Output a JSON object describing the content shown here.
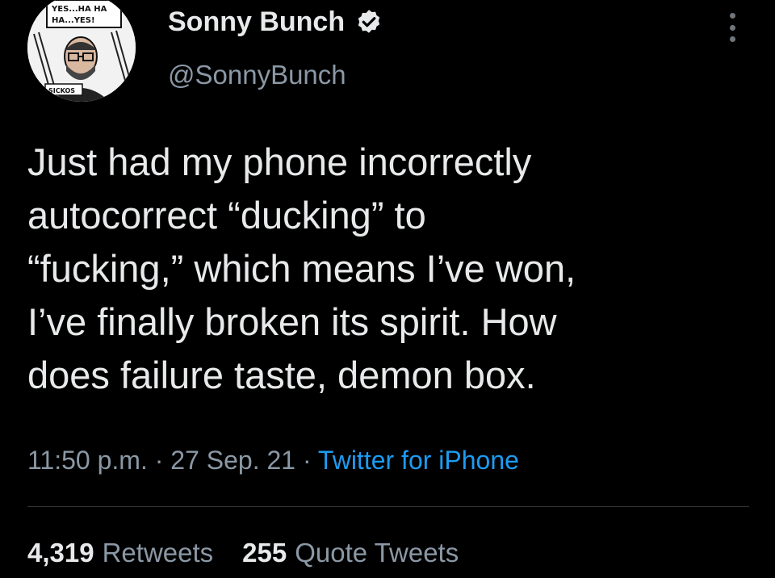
{
  "author": {
    "display_name": "Sonny Bunch",
    "handle": "@SonnyBunch",
    "avatar_text": [
      "YES...HA HA",
      "HA...YES!",
      "SICKOS"
    ]
  },
  "tweet": {
    "lines": [
      "Just had my phone incorrectly",
      "autocorrect “ducking” to",
      "“fucking,” which means I’ve won,",
      "I’ve finally broken its spirit. How",
      "does failure taste, demon box."
    ],
    "time": "11:50 p.m.",
    "date": "27 Sep. 21",
    "separator": "·",
    "source": "Twitter for iPhone"
  },
  "stats": {
    "retweets_count": "4,319",
    "retweets_label": "Retweets",
    "quotes_count": "255",
    "quotes_label": "Quote Tweets"
  },
  "icons": {
    "verified": "verified-badge-icon",
    "more": "more-options-icon"
  },
  "colors": {
    "background": "#000000",
    "text": "#e7e9ea",
    "secondary": "#8b98a5",
    "link": "#1d9bf0",
    "divider": "#2f3336"
  }
}
